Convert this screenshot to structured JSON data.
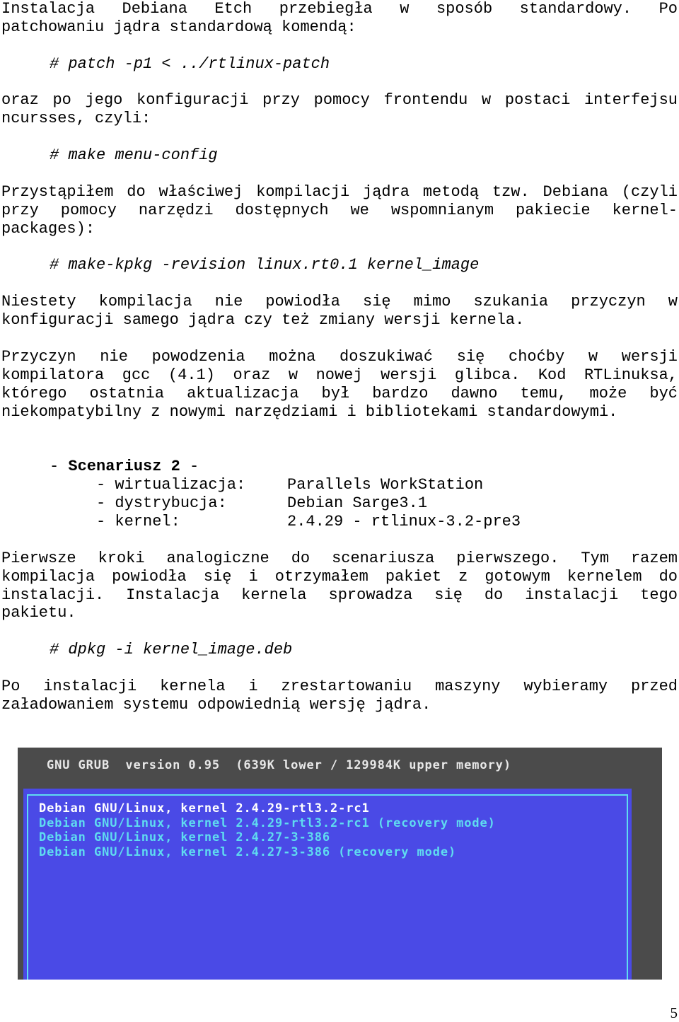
{
  "p1": [
    "Instalacja Debiana Etch przebiegła w sposób standardowy. Po",
    "patchowaniu jądra standardową komendą:"
  ],
  "code1": "# patch -p1 < ../rtlinux-patch",
  "p2": [
    "oraz po jego konfiguracji przy pomocy frontendu w postaci interfejsu",
    "ncursses, czyli:"
  ],
  "code2": "# make menu-config",
  "p3": [
    "Przystąpiłem do właściwej kompilacji jądra metodą tzw. Debiana (czyli",
    "przy pomocy narzędzi dostępnych we wspomnianym pakiecie kernel-",
    "packages):"
  ],
  "code3": "# make-kpkg -revision linux.rt0.1 kernel_image",
  "p4": [
    "Niestety kompilacja nie powiodła się mimo szukania przyczyn w",
    "konfiguracji samego jądra czy też zmiany wersji kernela."
  ],
  "p5": [
    "Przyczyn nie powodzenia można doszukiwać się choćby w wersji",
    "kompilatora gcc (4.1) oraz w nowej wersji glibca. Kod RTLinuksa,",
    "którego ostatnia aktualizacja był bardzo dawno temu, może być",
    "niekompatybilny z nowymi narzędziami i bibliotekami standardowymi."
  ],
  "scenario": {
    "dash_open": "- ",
    "title": "Scenariusz 2",
    "dash_close": " -",
    "items": [
      {
        "key": "- wirtualizacja:",
        "value": "Parallels WorkStation"
      },
      {
        "key": "- dystrybucja:",
        "value": "Debian Sarge3.1"
      },
      {
        "key": "- kernel:",
        "value": "2.4.29 - rtlinux-3.2-pre3"
      }
    ]
  },
  "p6": [
    "Pierwsze kroki analogiczne do scenariusza pierwszego. Tym razem",
    "kompilacja powiodła się i otrzymałem pakiet z gotowym kernelem do",
    "instalacji. Instalacja kernela sprowadza się do instalacji tego",
    "pakietu."
  ],
  "code4": "# dpkg -i kernel_image.deb",
  "p7": [
    "Po instalacji kernela i zrestartowaniu maszyny wybieramy przed",
    "załadowaniem systemu odpowiednią wersję jądra."
  ],
  "grub": {
    "header": "GNU GRUB  version 0.95  (639K lower / 129984K upper memory)",
    "entries": [
      "Debian GNU/Linux, kernel 2.4.29-rtl3.2-rc1",
      "Debian GNU/Linux, kernel 2.4.29-rtl3.2-rc1 (recovery mode)",
      "Debian GNU/Linux, kernel 2.4.27-3-386",
      "Debian GNU/Linux, kernel 2.4.27-3-386 (recovery mode)"
    ],
    "selected_index": 0,
    "colors": {
      "background": "#4b4b4b",
      "menu": "#4a4ae6",
      "border": "#5fdcf0",
      "selected": "#ffffff"
    }
  },
  "page_number": "5"
}
